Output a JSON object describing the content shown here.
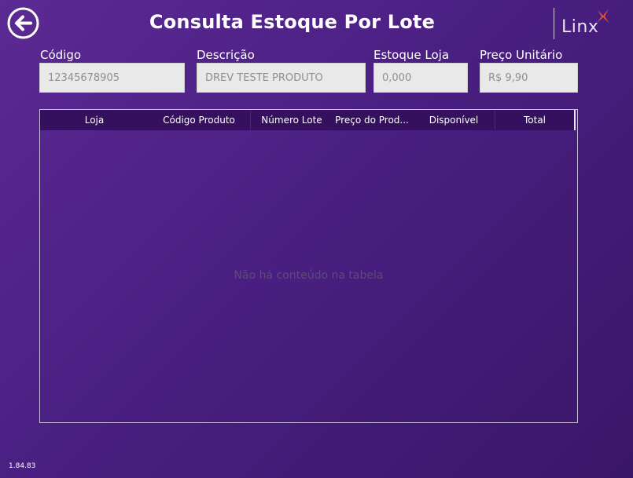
{
  "header": {
    "title": "Consulta Estoque Por Lote",
    "logo_text": "Linx"
  },
  "fields": [
    {
      "label": "Código",
      "value": "12345678905"
    },
    {
      "label": "Descrição",
      "value": "DREV TESTE PRODUTO"
    },
    {
      "label": "Estoque Loja",
      "value": "0,000"
    },
    {
      "label": "Preço Unitário",
      "value": "R$ 9,90"
    }
  ],
  "table": {
    "columns": [
      "Loja",
      "Código Produto",
      "Número Lote",
      "Preço do Prod...",
      "Disponível",
      "Total"
    ],
    "empty_message": "Não há conteúdo na tabela"
  },
  "footer": {
    "version": "1.84.83"
  },
  "colors": {
    "background": "#4a1f82",
    "table_header": "#35105f",
    "logo_accent": "#e8513a"
  },
  "icons": {
    "back": "arrow-left-circle-icon",
    "logo": "linx-star-icon"
  }
}
